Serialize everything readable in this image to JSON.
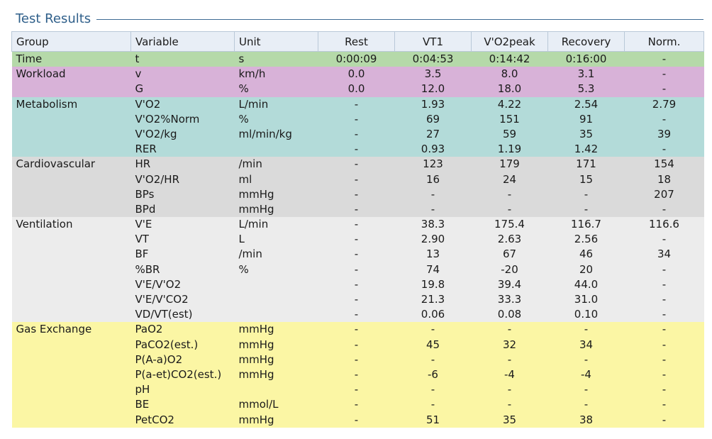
{
  "title": "Test Results",
  "columns": [
    "Group",
    "Variable",
    "Unit",
    "Rest",
    "VT1",
    "V'O2peak",
    "Recovery",
    "Norm."
  ],
  "groups": [
    {
      "key": "time",
      "name": "Time",
      "color": "#b5d9a9",
      "rows": [
        {
          "variable": "t",
          "unit": "s",
          "rest": "0:00:09",
          "vt1": "0:04:53",
          "vo2peak": "0:14:42",
          "recovery": "0:16:00",
          "norm": "-"
        }
      ]
    },
    {
      "key": "workload",
      "name": "Workload",
      "color": "#d8b2d8",
      "rows": [
        {
          "variable": "v",
          "unit": "km/h",
          "rest": "0.0",
          "vt1": "3.5",
          "vo2peak": "8.0",
          "recovery": "3.1",
          "norm": "-"
        },
        {
          "variable": "G",
          "unit": "%",
          "rest": "0.0",
          "vt1": "12.0",
          "vo2peak": "18.0",
          "recovery": "5.3",
          "norm": "-"
        }
      ]
    },
    {
      "key": "metabolism",
      "name": "Metabolism",
      "color": "#b3dbd9",
      "rows": [
        {
          "variable": "V'O2",
          "unit": "L/min",
          "rest": "-",
          "vt1": "1.93",
          "vo2peak": "4.22",
          "recovery": "2.54",
          "norm": "2.79"
        },
        {
          "variable": "V'O2%Norm",
          "unit": "%",
          "rest": "-",
          "vt1": "69",
          "vo2peak": "151",
          "recovery": "91",
          "norm": "-"
        },
        {
          "variable": "V'O2/kg",
          "unit": "ml/min/kg",
          "rest": "-",
          "vt1": "27",
          "vo2peak": "59",
          "recovery": "35",
          "norm": "39"
        },
        {
          "variable": "RER",
          "unit": "",
          "rest": "-",
          "vt1": "0.93",
          "vo2peak": "1.19",
          "recovery": "1.42",
          "norm": "-"
        }
      ]
    },
    {
      "key": "cardio",
      "name": "Cardiovascular",
      "color": "#dadada",
      "rows": [
        {
          "variable": "HR",
          "unit": "/min",
          "rest": "-",
          "vt1": "123",
          "vo2peak": "179",
          "recovery": "171",
          "norm": "154"
        },
        {
          "variable": "V'O2/HR",
          "unit": "ml",
          "rest": "-",
          "vt1": "16",
          "vo2peak": "24",
          "recovery": "15",
          "norm": "18"
        },
        {
          "variable": "BPs",
          "unit": "mmHg",
          "rest": "-",
          "vt1": "-",
          "vo2peak": "-",
          "recovery": "-",
          "norm": "207"
        },
        {
          "variable": "BPd",
          "unit": "mmHg",
          "rest": "-",
          "vt1": "-",
          "vo2peak": "-",
          "recovery": "-",
          "norm": "-"
        }
      ]
    },
    {
      "key": "vent",
      "name": "Ventilation",
      "color": "#ececec",
      "rows": [
        {
          "variable": "V'E",
          "unit": "L/min",
          "rest": "-",
          "vt1": "38.3",
          "vo2peak": "175.4",
          "recovery": "116.7",
          "norm": "116.6"
        },
        {
          "variable": "VT",
          "unit": "L",
          "rest": "-",
          "vt1": "2.90",
          "vo2peak": "2.63",
          "recovery": "2.56",
          "norm": "-"
        },
        {
          "variable": "BF",
          "unit": "/min",
          "rest": "-",
          "vt1": "13",
          "vo2peak": "67",
          "recovery": "46",
          "norm": "34"
        },
        {
          "variable": "%BR",
          "unit": "%",
          "rest": "-",
          "vt1": "74",
          "vo2peak": "-20",
          "recovery": "20",
          "norm": "-"
        },
        {
          "variable": "V'E/V'O2",
          "unit": "",
          "rest": "-",
          "vt1": "19.8",
          "vo2peak": "39.4",
          "recovery": "44.0",
          "norm": "-"
        },
        {
          "variable": "V'E/V'CO2",
          "unit": "",
          "rest": "-",
          "vt1": "21.3",
          "vo2peak": "33.3",
          "recovery": "31.0",
          "norm": "-"
        },
        {
          "variable": "VD/VT(est)",
          "unit": "",
          "rest": "-",
          "vt1": "0.06",
          "vo2peak": "0.08",
          "recovery": "0.10",
          "norm": "-"
        }
      ]
    },
    {
      "key": "gas",
      "name": "Gas Exchange",
      "color": "#fbf6a4",
      "rows": [
        {
          "variable": "PaO2",
          "unit": "mmHg",
          "rest": "-",
          "vt1": "-",
          "vo2peak": "-",
          "recovery": "-",
          "norm": "-"
        },
        {
          "variable": "PaCO2(est.)",
          "unit": "mmHg",
          "rest": "-",
          "vt1": "45",
          "vo2peak": "32",
          "recovery": "34",
          "norm": "-"
        },
        {
          "variable": "P(A-a)O2",
          "unit": "mmHg",
          "rest": "-",
          "vt1": "-",
          "vo2peak": "-",
          "recovery": "-",
          "norm": "-"
        },
        {
          "variable": "P(a-et)CO2(est.)",
          "unit": "mmHg",
          "rest": "-",
          "vt1": "-6",
          "vo2peak": "-4",
          "recovery": "-4",
          "norm": "-"
        },
        {
          "variable": "pH",
          "unit": "",
          "rest": "-",
          "vt1": "-",
          "vo2peak": "-",
          "recovery": "-",
          "norm": "-"
        },
        {
          "variable": "BE",
          "unit": "mmol/L",
          "rest": "-",
          "vt1": "-",
          "vo2peak": "-",
          "recovery": "-",
          "norm": "-"
        },
        {
          "variable": "PetCO2",
          "unit": "mmHg",
          "rest": "-",
          "vt1": "51",
          "vo2peak": "35",
          "recovery": "38",
          "norm": "-"
        }
      ]
    }
  ]
}
